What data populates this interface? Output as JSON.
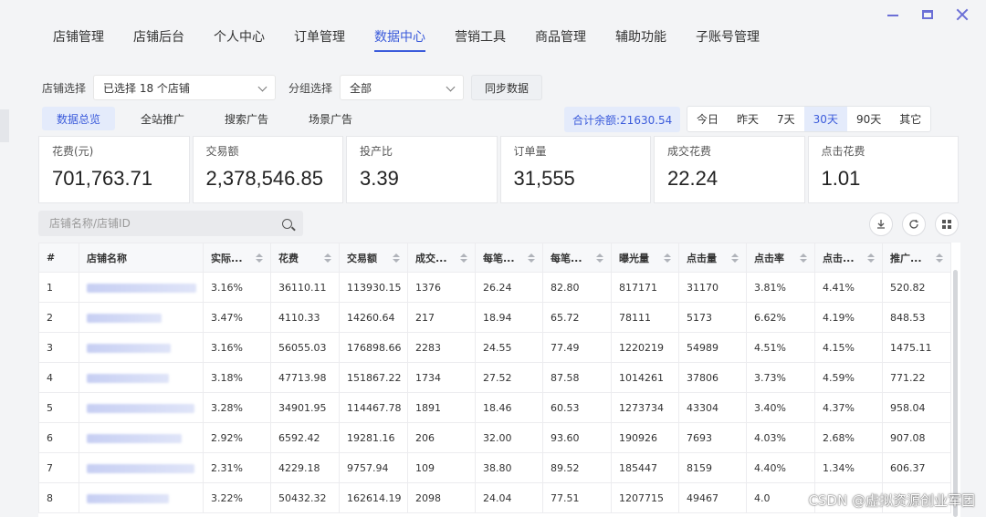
{
  "nav": {
    "items": [
      "店铺管理",
      "店铺后台",
      "个人中心",
      "订单管理",
      "数据中心",
      "营销工具",
      "商品管理",
      "辅助功能",
      "子账号管理"
    ],
    "active": "数据中心"
  },
  "filters": {
    "shop_label": "店铺选择",
    "shop_value": "已选择 18 个店铺",
    "group_label": "分组选择",
    "group_value": "全部",
    "sync_label": "同步数据"
  },
  "subtabs": [
    "数据总览",
    "全站推广",
    "搜索广告",
    "场景广告"
  ],
  "balance": "合计余额:21630.54",
  "ranges": [
    "今日",
    "昨天",
    "7天",
    "30天",
    "90天",
    "其它"
  ],
  "active_range": "30天",
  "stats": [
    {
      "label": "花费(元)",
      "value": "701,763.71"
    },
    {
      "label": "交易额",
      "value": "2,378,546.85"
    },
    {
      "label": "投产比",
      "value": "3.39"
    },
    {
      "label": "订单量",
      "value": "31,555"
    },
    {
      "label": "成交花费",
      "value": "22.24"
    },
    {
      "label": "点击花费",
      "value": "1.01"
    }
  ],
  "search": {
    "placeholder": "店铺名称/店铺ID"
  },
  "table": {
    "headers": [
      "#",
      "店铺名称",
      "实际...",
      "花费",
      "交易额",
      "成交...",
      "每笔...",
      "每笔...",
      "曝光量",
      "点击量",
      "点击率",
      "点击...",
      "推广..."
    ],
    "rows": [
      [
        "1",
        "",
        "3.16%",
        "36110.11",
        "113930.15",
        "1376",
        "26.24",
        "82.80",
        "817171",
        "31170",
        "3.81%",
        "4.41%",
        "520.82"
      ],
      [
        "2",
        "",
        "3.47%",
        "4110.33",
        "14260.64",
        "217",
        "18.94",
        "65.72",
        "78111",
        "5173",
        "6.62%",
        "4.19%",
        "848.53"
      ],
      [
        "3",
        "",
        "3.16%",
        "56055.03",
        "176898.66",
        "2283",
        "24.55",
        "77.49",
        "1220219",
        "54989",
        "4.51%",
        "4.15%",
        "1475.11"
      ],
      [
        "4",
        "",
        "3.18%",
        "47713.98",
        "151867.22",
        "1734",
        "27.52",
        "87.58",
        "1014261",
        "37806",
        "3.73%",
        "4.59%",
        "771.22"
      ],
      [
        "5",
        "",
        "3.28%",
        "34901.95",
        "114467.78",
        "1891",
        "18.46",
        "60.53",
        "1273734",
        "43304",
        "3.40%",
        "4.37%",
        "958.04"
      ],
      [
        "6",
        "",
        "2.92%",
        "6592.42",
        "19281.16",
        "206",
        "32.00",
        "93.60",
        "190926",
        "7693",
        "4.03%",
        "2.68%",
        "907.08"
      ],
      [
        "7",
        "",
        "2.31%",
        "4229.18",
        "9757.94",
        "109",
        "38.80",
        "89.52",
        "185447",
        "8159",
        "4.40%",
        "1.34%",
        "606.37"
      ],
      [
        "8",
        "",
        "3.22%",
        "50432.32",
        "162614.19",
        "2098",
        "24.04",
        "77.51",
        "1207715",
        "49467",
        "4.0",
        "",
        ""
      ]
    ]
  },
  "watermark": "CSDN @虚拟资源创业军团"
}
